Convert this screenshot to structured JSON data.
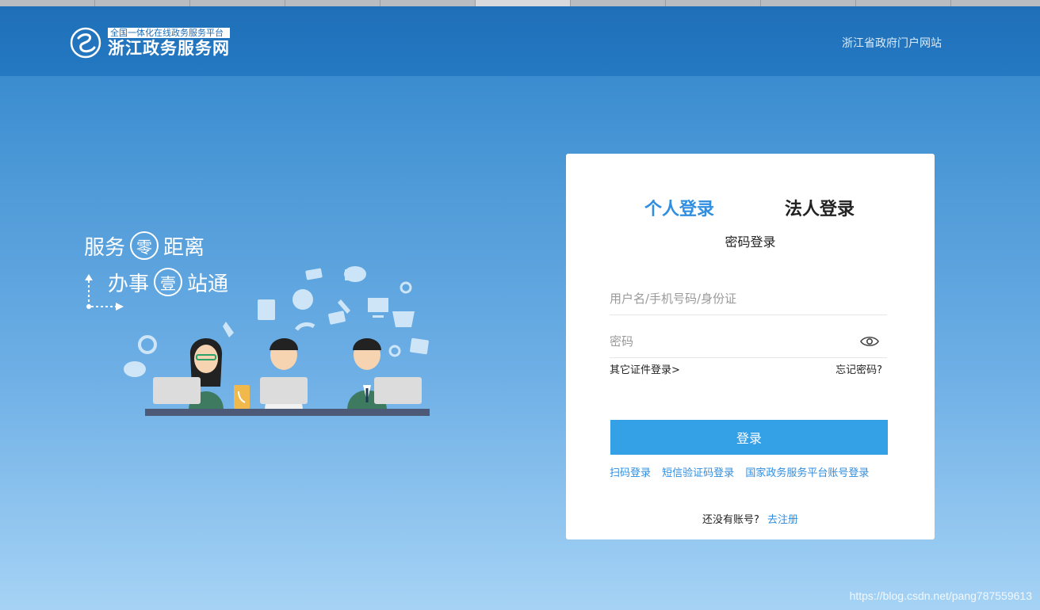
{
  "header": {
    "logo_subtitle": "全国一体化在线政务服务平台",
    "logo_title": "浙江政务服务网",
    "portal_link": "浙江省政府门户网站"
  },
  "slogan": {
    "line1_pre": "服务",
    "line1_circle": "零",
    "line1_post": "距离",
    "line2_pre": "办事",
    "line2_circle": "壹",
    "line2_post": "站通"
  },
  "login": {
    "tabs": [
      {
        "label": "个人登录",
        "active": true
      },
      {
        "label": "法人登录",
        "active": false
      }
    ],
    "subtitle": "密码登录",
    "username_placeholder": "用户名/手机号码/身份证",
    "password_placeholder": "密码",
    "other_cert_login": "其它证件登录>",
    "forgot_password": "忘记密码?",
    "login_button": "登录",
    "alt_logins": [
      "扫码登录",
      "短信验证码登录",
      "国家政务服务平台账号登录"
    ],
    "register_question": "还没有账号?",
    "register_link": "去注册"
  },
  "watermark": "https://blog.csdn.net/pang787559613",
  "colors": {
    "header_bg": "#1f6fb8",
    "accent": "#2f8ee0",
    "button": "#34a0e6"
  }
}
